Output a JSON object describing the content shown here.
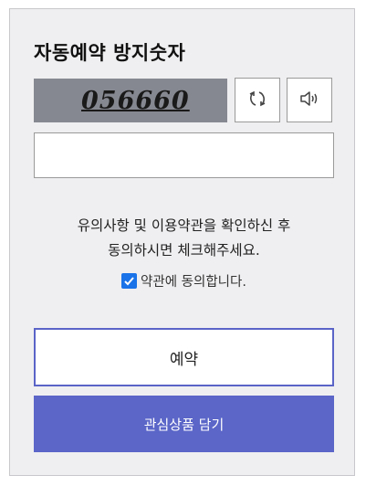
{
  "panel": {
    "title": "자동예약 방지숫자",
    "captcha": {
      "code": "056660",
      "refresh_icon": "refresh-icon",
      "sound_icon": "speaker-icon"
    },
    "input": {
      "value": "",
      "placeholder": ""
    },
    "notice_line1": "유의사항 및 이용약관을 확인하신 후",
    "notice_line2": "동의하시면 체크해주세요.",
    "agree": {
      "label": "약관에 동의합니다.",
      "checked": true
    },
    "reserve_label": "예약",
    "wishlist_label": "관심상품 담기"
  },
  "colors": {
    "accent": "#5b66c8",
    "captcha_bg": "#868891",
    "panel_bg": "#efeff1"
  }
}
